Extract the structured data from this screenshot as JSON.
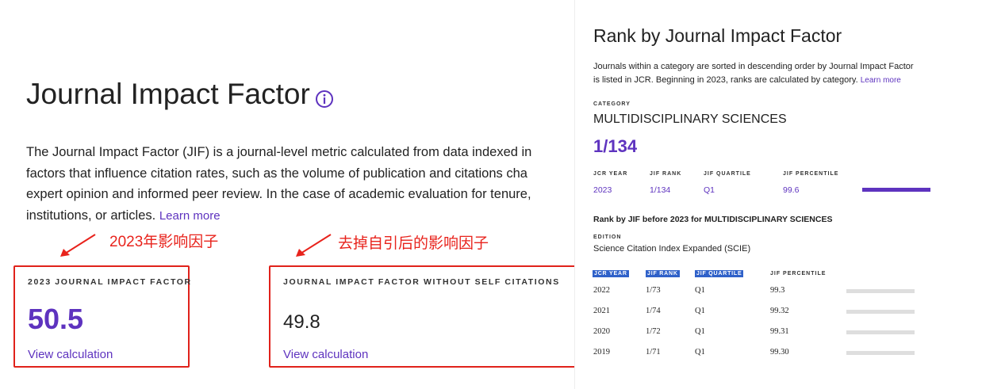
{
  "left": {
    "title": "Journal Impact Factor",
    "description_lines": [
      "The Journal Impact Factor (JIF) is a journal-level metric calculated from data indexed in",
      "factors that influence citation rates, such as the volume of publication and citations cha",
      "expert opinion and informed peer review. In the case of academic evaluation for tenure,",
      "institutions, or articles."
    ],
    "learn_more": "Learn more",
    "annotation_1": "2023年影响因子",
    "annotation_2": "去掉自引后的影响因子",
    "card_1": {
      "label": "2023 JOURNAL IMPACT FACTOR",
      "value": "50.5",
      "link": "View calculation"
    },
    "card_2": {
      "label": "JOURNAL IMPACT FACTOR WITHOUT SELF CITATIONS",
      "value": "49.8",
      "link": "View calculation"
    }
  },
  "right": {
    "title": "Rank by Journal Impact Factor",
    "description_lines": [
      "Journals within a category are sorted in descending order by Journal Impact Factor",
      "is listed in JCR. Beginning in 2023, ranks are calculated by category."
    ],
    "learn_more": "Learn more",
    "category_label": "CATEGORY",
    "category": "MULTIDISCIPLINARY SCIENCES",
    "rank": "1/134",
    "current_headers": [
      "JCR YEAR",
      "JIF RANK",
      "JIF QUARTILE",
      "JIF PERCENTILE"
    ],
    "current_row": {
      "year": "2023",
      "rank": "1/134",
      "quartile": "Q1",
      "percentile": "99.6",
      "percentile_fill": 0.996
    },
    "before_title": "Rank by JIF before 2023 for MULTIDISCIPLINARY SCIENCES",
    "edition_label": "EDITION",
    "edition": "Science Citation Index Expanded (SCIE)",
    "history_headers": [
      "JCR YEAR",
      "JIF RANK",
      "JIF QUARTILE",
      "JIF PERCENTILE"
    ],
    "history_rows": [
      {
        "year": "2022",
        "rank": "1/73",
        "quartile": "Q1",
        "percentile": "99.3"
      },
      {
        "year": "2021",
        "rank": "1/74",
        "quartile": "Q1",
        "percentile": "99.32"
      },
      {
        "year": "2020",
        "rank": "1/72",
        "quartile": "Q1",
        "percentile": "99.31"
      },
      {
        "year": "2019",
        "rank": "1/71",
        "quartile": "Q1",
        "percentile": "99.30"
      }
    ]
  },
  "colors": {
    "accent": "#5e33bf",
    "annotation_red": "#e8231c",
    "highlight_blue": "#2f61c9",
    "bar_gray": "#dedede"
  }
}
